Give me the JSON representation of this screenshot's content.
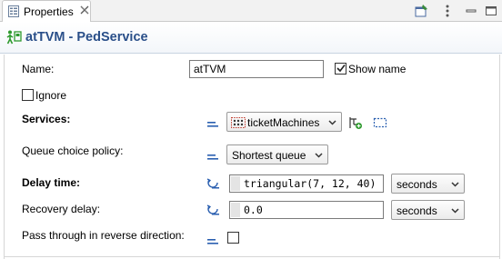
{
  "tab": {
    "label": "Properties",
    "icon": "properties-icon"
  },
  "toolbar": {
    "buttons": [
      "pin-icon",
      "view-menu-icon",
      "minimize-icon",
      "maximize-icon"
    ]
  },
  "header": {
    "title": "atTVM - PedService",
    "icon": "ped-service-icon"
  },
  "fields": {
    "name": {
      "label": "Name:",
      "value": "atTVM",
      "show_name_label": "Show name",
      "show_name_checked": true
    },
    "ignore": {
      "label": "Ignore",
      "checked": false
    },
    "services": {
      "label": "Services:",
      "value": "ticketMachines"
    },
    "queue_choice": {
      "label": "Queue choice policy:",
      "value": "Shortest queue"
    },
    "delay_time": {
      "label": "Delay time:",
      "value": "triangular(7, 12, 40)",
      "unit": "seconds"
    },
    "recovery_delay": {
      "label": "Recovery delay:",
      "value": "0.0",
      "unit": "seconds"
    },
    "pass_through": {
      "label": "Pass through in reverse direction:",
      "checked": false
    }
  },
  "colors": {
    "header_title": "#2a4f89",
    "mode_icon": "#2a5fb0",
    "dynamic_icon": "#2a5fb0"
  }
}
